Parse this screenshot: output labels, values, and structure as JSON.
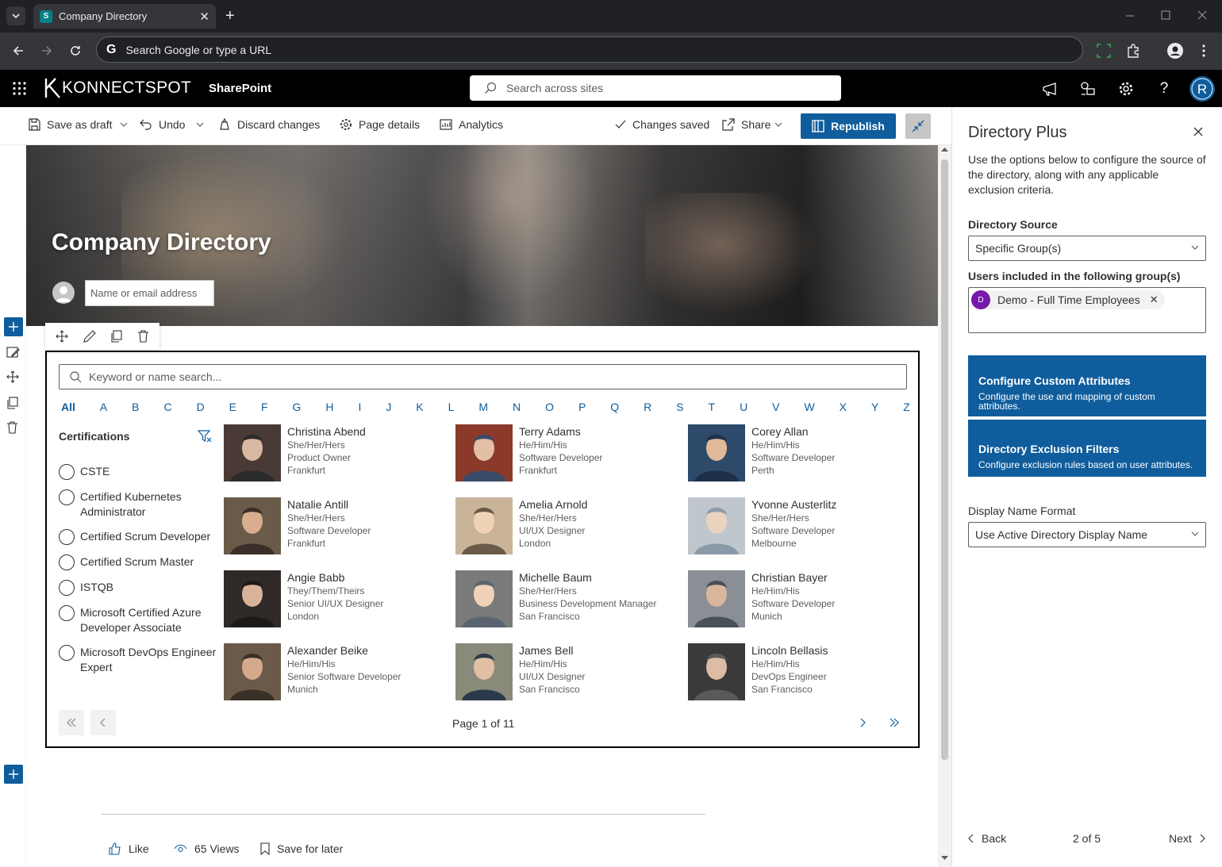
{
  "browser": {
    "tab_title": "Company Directory",
    "omnibox_placeholder": "Search Google or type a URL"
  },
  "suitebar": {
    "logo_text": "KONNECTSPOT",
    "app_name": "SharePoint",
    "search_placeholder": "Search across sites",
    "avatar_initial": "R"
  },
  "commandbar": {
    "save_as_draft": "Save as draft",
    "undo": "Undo",
    "discard_changes": "Discard changes",
    "page_details": "Page details",
    "analytics": "Analytics",
    "status": "Changes saved",
    "share": "Share",
    "republish": "Republish"
  },
  "hero": {
    "title": "Company Directory",
    "name_placeholder": "Name or email address"
  },
  "directory": {
    "search_placeholder": "Keyword or name search...",
    "alphabet": [
      "All",
      "A",
      "B",
      "C",
      "D",
      "E",
      "F",
      "G",
      "H",
      "I",
      "J",
      "K",
      "L",
      "M",
      "N",
      "O",
      "P",
      "Q",
      "R",
      "S",
      "T",
      "U",
      "V",
      "W",
      "X",
      "Y",
      "Z"
    ],
    "active_letter": "All",
    "certifications_title": "Certifications",
    "certifications": [
      "CSTE",
      "Certified Kubernetes Administrator",
      "Certified Scrum Developer",
      "Certified Scrum Master",
      "ISTQB",
      "Microsoft Certified Azure Developer Associate",
      "Microsoft DevOps Engineer Expert"
    ],
    "people": [
      {
        "name": "Christina Abend",
        "pronouns": "She/Her/Hers",
        "title": "Product Owner",
        "location": "Frankfurt"
      },
      {
        "name": "Terry Adams",
        "pronouns": "He/Him/His",
        "title": "Software Developer",
        "location": "Frankfurt"
      },
      {
        "name": "Corey Allan",
        "pronouns": "He/Him/His",
        "title": "Software Developer",
        "location": "Perth"
      },
      {
        "name": "Natalie Antill",
        "pronouns": "She/Her/Hers",
        "title": "Software Developer",
        "location": "Frankfurt"
      },
      {
        "name": "Amelia Arnold",
        "pronouns": "She/Her/Hers",
        "title": "UI/UX Designer",
        "location": "London"
      },
      {
        "name": "Yvonne Austerlitz",
        "pronouns": "She/Her/Hers",
        "title": "Software Developer",
        "location": "Melbourne"
      },
      {
        "name": "Angie Babb",
        "pronouns": "They/Them/Theirs",
        "title": "Senior UI/UX Designer",
        "location": "London"
      },
      {
        "name": "Michelle Baum",
        "pronouns": "She/Her/Hers",
        "title": "Business Development Manager",
        "location": "San Francisco"
      },
      {
        "name": "Christian Bayer",
        "pronouns": "He/Him/His",
        "title": "Software Developer",
        "location": "Munich"
      },
      {
        "name": "Alexander Beike",
        "pronouns": "He/Him/His",
        "title": "Senior Software Developer",
        "location": "Munich"
      },
      {
        "name": "James Bell",
        "pronouns": "He/Him/His",
        "title": "UI/UX Designer",
        "location": "San Francisco"
      },
      {
        "name": "Lincoln Bellasis",
        "pronouns": "He/Him/His",
        "title": "DevOps Engineer",
        "location": "San Francisco"
      }
    ],
    "page_label": "Page 1 of 11"
  },
  "social": {
    "like": "Like",
    "views": "65 Views",
    "save_for_later": "Save for later"
  },
  "panel": {
    "title": "Directory Plus",
    "description": "Use the options below to configure the source of the directory, along with any applicable exclusion criteria.",
    "source_label": "Directory Source",
    "source_value": "Specific Group(s)",
    "groups_label": "Users included in the following group(s)",
    "group_pill": "Demo - Full Time Employees",
    "group_initial": "D",
    "custom_attr_title": "Configure Custom Attributes",
    "custom_attr_desc": "Configure the use and mapping of custom attributes.",
    "exclusion_title": "Directory Exclusion Filters",
    "exclusion_desc": "Configure exclusion rules based on user attributes.",
    "display_format_label": "Display Name Format",
    "display_format_value": "Use Active Directory Display Name",
    "back": "Back",
    "step": "2 of 5",
    "next": "Next"
  },
  "colors": {
    "accent": "#0f5d9c",
    "suitebar": "#000000",
    "browser_chrome": "#202124"
  }
}
